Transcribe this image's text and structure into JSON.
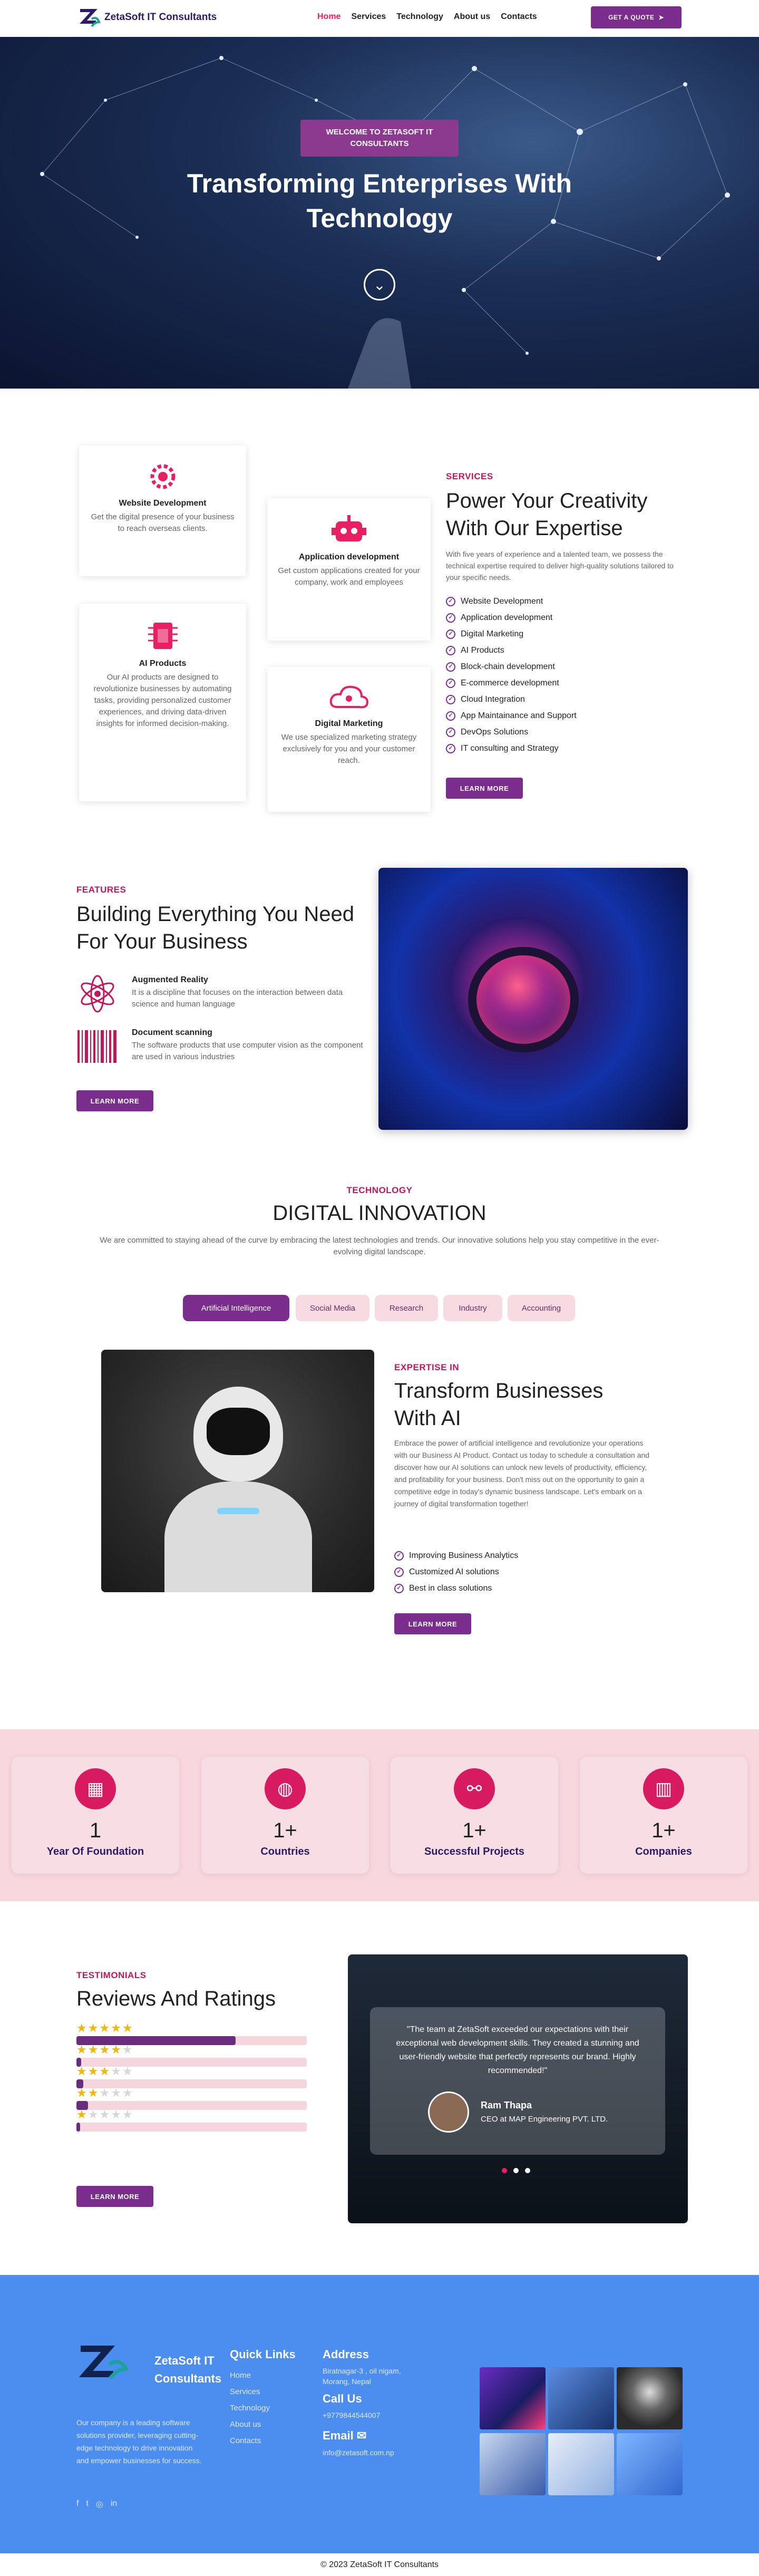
{
  "nav": {
    "brand": "ZetaSoft IT Consultants",
    "links": [
      "Home",
      "Services",
      "Technology",
      "About us",
      "Contacts"
    ],
    "cta": "GET A QUOTE"
  },
  "hero": {
    "badge": "WELCOME TO ZETASOFT IT CONSULTANTS",
    "title": "Transforming Enterprises With Technology"
  },
  "services": {
    "eyebrow": "SERVICES",
    "title": "Power Your Creativity With Our Expertise",
    "text": "With five years of experience and a talented team, we possess the technical expertise required to deliver high-quality solutions tailored to your specific needs.",
    "list": [
      "Website Development",
      "Application development",
      "Digital Marketing",
      "AI Products",
      "Block-chain development",
      "E-commerce development",
      "Cloud Integration",
      "App Maintainance and Support",
      "DevOps Solutions",
      "IT consulting and Strategy"
    ],
    "button": "LEARN MORE",
    "cards": [
      {
        "title": "Website Development",
        "text": "Get the digital presence of your business to reach overseas clients."
      },
      {
        "title": "Application development",
        "text": "Get custom applications created for your company, work and employees"
      },
      {
        "title": "AI Products",
        "text": "Our AI products are designed to revolutionize businesses by automating tasks, providing personalized customer experiences, and driving data-driven insights for informed decision-making."
      },
      {
        "title": "Digital Marketing",
        "text": "We use specialized marketing strategy exclusively for you and your customer reach."
      }
    ]
  },
  "features": {
    "eyebrow": "FEATURES",
    "title": "Building Everything You Need For Your Business",
    "items": [
      {
        "title": "Augmented Reality",
        "text": "It is a discipline that focuses on the interaction between data science and human language"
      },
      {
        "title": "Document scanning",
        "text": "The software products that use computer vision as the component are used in various industries"
      }
    ],
    "button": "LEARN MORE"
  },
  "technology": {
    "eyebrow": "TECHNOLOGY",
    "title": "DIGITAL INNOVATION",
    "text": "We are committed to staying ahead of the curve by embracing the latest technologies and trends. Our innovative solutions help you stay competitive in the ever-evolving digital landscape.",
    "tabs": [
      "Artificial Intelligence",
      "Social Media",
      "Research",
      "Industry",
      "Accounting"
    ]
  },
  "expertise": {
    "eyebrow": "EXPERTISE IN",
    "title": "Transform Businesses With AI",
    "text": "Embrace the power of artificial intelligence and revolutionize your operations with our Business AI Product. Contact us today to schedule a consultation and discover how our AI solutions can unlock new levels of productivity, efficiency, and profitability for your business. Don't miss out on the opportunity to gain a competitive edge in today's dynamic business landscape. Let's embark on a journey of digital transformation together!",
    "list": [
      "Improving Business Analytics",
      "Customized AI solutions",
      "Best in class solutions"
    ],
    "button": "LEARN MORE"
  },
  "stats": [
    {
      "icon": "calendar-icon",
      "value": "1",
      "label": "Year Of Foundation"
    },
    {
      "icon": "globe-icon",
      "value": "1+",
      "label": "Countries"
    },
    {
      "icon": "network-icon",
      "value": "1+",
      "label": "Successful Projects"
    },
    {
      "icon": "building-icon",
      "value": "1+",
      "label": "Companies"
    }
  ],
  "testimonials": {
    "eyebrow": "TESTIMONIALS",
    "title": "Reviews And Ratings",
    "ratings": [
      {
        "stars": 5,
        "fraction": 0.69
      },
      {
        "stars": 4,
        "fraction": 0.02
      },
      {
        "stars": 3,
        "fraction": 0.03
      },
      {
        "stars": 2,
        "fraction": 0.05
      },
      {
        "stars": 1,
        "fraction": 0.01
      }
    ],
    "button": "LEARN MORE",
    "quote": "\"The team at ZetaSoft exceeded our expectations with their exceptional web development skills. They created a stunning and user-friendly website that perfectly represents our brand. Highly recommended!\"",
    "author": "Ram Thapa",
    "role": "CEO at MAP Engineering PVT. LTD."
  },
  "footer": {
    "brand": "ZetaSoft IT Consultants",
    "about": "Our company is a leading software solutions provider, leveraging cutting-edge technology to drive innovation and empower businesses for success.",
    "quick_links_title": "Quick Links",
    "quick_links": [
      "Home",
      "Services",
      "Technology",
      "About us",
      "Contacts"
    ],
    "address_title": "Address",
    "address": "Biratnagar-3 , oil nigam, Morang, Nepal",
    "call_title": "Call Us",
    "phone": "+9779844544007",
    "email_title": "Email",
    "email": "info@zetasoft.com.np",
    "copyright": "© 2023 ZetaSoft IT Consultants"
  },
  "colors": {
    "primary": "#7b2d8e",
    "accent": "#e91e63",
    "footer": "#4c8df0",
    "stats_band": "#f8d7df"
  }
}
